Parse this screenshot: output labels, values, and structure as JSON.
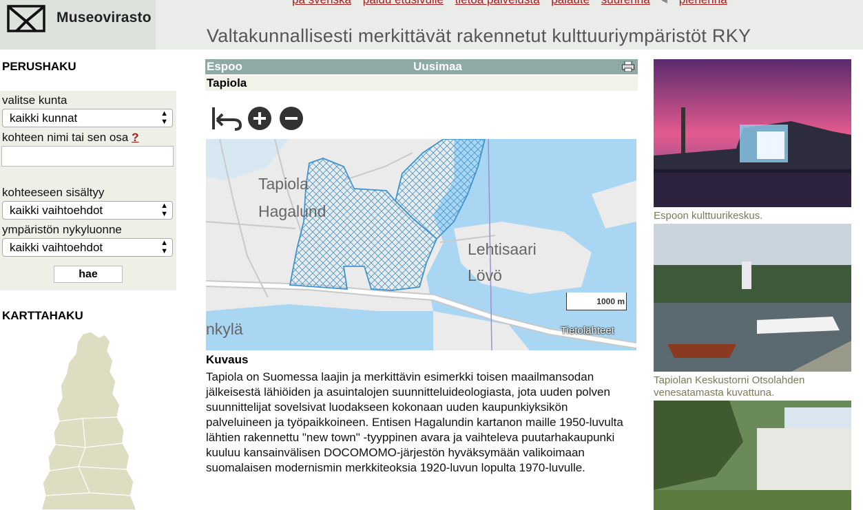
{
  "header": {
    "logo_text": "Museovirasto",
    "links": [
      "på svenska",
      "paluu etusivulle",
      "tietoa palvelusta",
      "palaute",
      "suurenna",
      "pienennä"
    ],
    "separator": "◂",
    "title": "Valtakunnallisesti merkittävät rakennetut kulttuuriympäristöt RKY"
  },
  "search": {
    "heading": "PERUSHAKU",
    "municipality_label": "valitse kunta",
    "municipality_value": "kaikki kunnat",
    "name_label": "kohteen nimi tai sen osa",
    "help_mark": "?",
    "name_value": "",
    "contains_label": "kohteeseen sisältyy",
    "contains_value": "kaikki vaihtoehdot",
    "character_label": "ympäristön nykyluonne",
    "character_value": "kaikki vaihtoehdot",
    "search_button": "hae",
    "map_search_heading": "KARTTAHAKU"
  },
  "record": {
    "municipality": "Espoo",
    "region": "Uusimaa",
    "name": "Tapiola"
  },
  "map": {
    "labels": [
      "Tapiola",
      "Hagalund",
      "Lehtisaari",
      "Lövö",
      "nkylä"
    ],
    "scale_label": "1000 m",
    "attribution": "Tietolähteet"
  },
  "description": {
    "heading": "Kuvaus",
    "text": "Tapiola on Suomessa laajin ja merkittävin esimerkki toisen maailmansodan jälkeisestä lähiöiden ja asuintalojen suunnitteluideologiasta, jota uuden polven suunnittelijat sovelsivat luodakseen kokonaan uuden kaupunkiyksikön palveluineen ja työpaikkoineen. Entisen Hagalundin kartanon maille 1950-luvulta lähtien rakennettu \"new town\" -tyyppinen avara ja vaihteleva puutarhakaupunki kuuluu kansainvälisen DOCOMOMO-järjestön hyväksymään valikoimaan suomalaisen modernismin merkkiteoksia 1920-luvun lopulta 1970-luvulle."
  },
  "photos": [
    {
      "caption": "Espoon kulttuurikeskus."
    },
    {
      "caption": "Tapiolan Keskustorni Otsolahden venesatamasta kuvattuna."
    },
    {
      "caption": ""
    }
  ],
  "icons": [
    "museovirasto-logo-icon",
    "printer-icon",
    "map-reset-icon",
    "zoom-in-icon",
    "zoom-out-icon",
    "select-arrow-icon"
  ],
  "colors": {
    "link": "#a61c1c",
    "record_bar": "#8fa9a4",
    "panel_bg": "#eeefe7",
    "caption": "#7a7a5a",
    "water": "#a9d6f2"
  }
}
